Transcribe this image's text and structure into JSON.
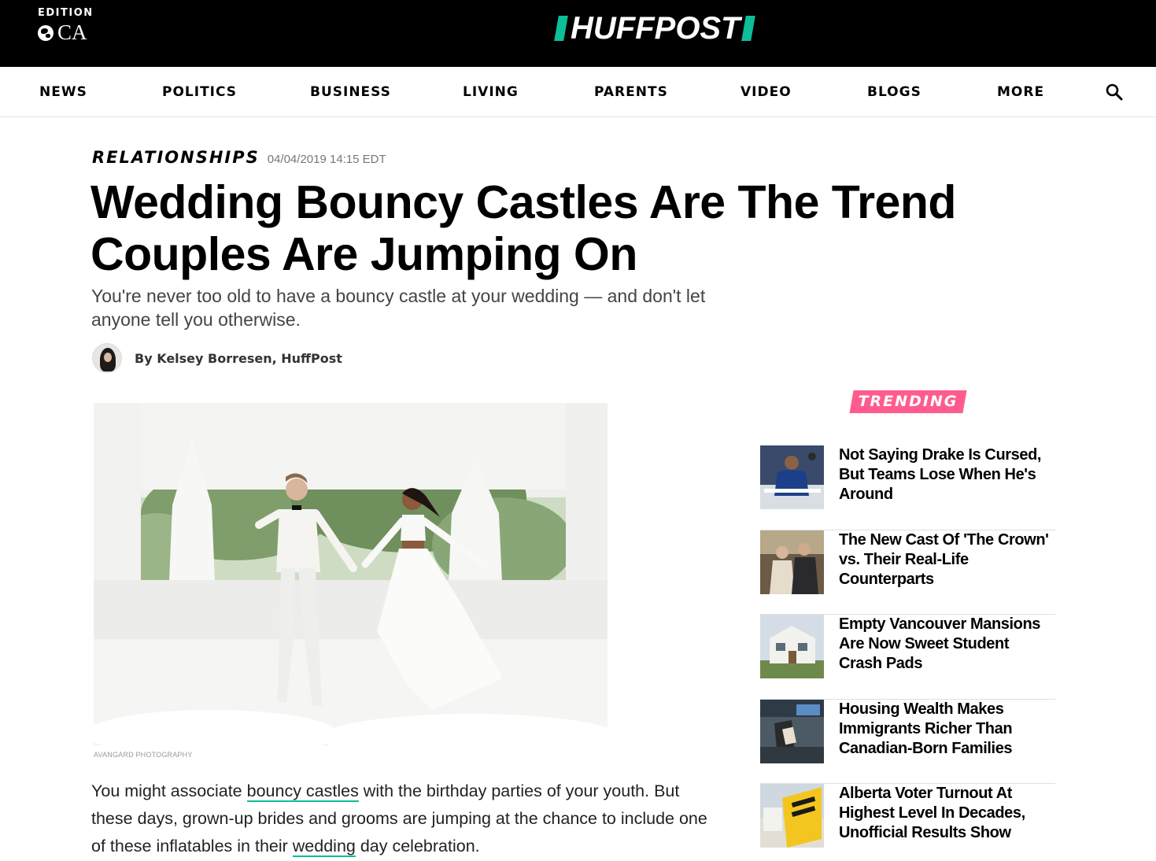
{
  "header": {
    "edition_label": "EDITION",
    "edition_code": "CA",
    "logo_text": "HUFFPOST"
  },
  "nav": {
    "items": [
      "NEWS",
      "POLITICS",
      "BUSINESS",
      "LIVING",
      "PARENTS",
      "VIDEO",
      "BLOGS",
      "MORE"
    ],
    "search_icon": "search-icon"
  },
  "article": {
    "section": "RELATIONSHIPS",
    "timestamp": "04/04/2019 14:15 EDT",
    "headline": "Wedding Bouncy Castles Are The Trend Couples Are Jumping On",
    "dek": "You're never too old to have a bouncy castle at your wedding — and don't let anyone tell you otherwise.",
    "byline": "By Kelsey Borresen, HuffPost",
    "image_credit": "AVANGARD PHOTOGRAPHY",
    "body": {
      "p1_a": "You might associate ",
      "p1_link1": "bouncy castles",
      "p1_b": " with the birthday parties of your youth. But these days, grown-up brides and grooms are jumping at the chance to include one of these inflatables in their ",
      "p1_link2": "wedding",
      "p1_c": " day celebration."
    }
  },
  "trending": {
    "label": "TRENDING",
    "items": [
      {
        "title": "Not Saying Drake Is Cursed, But Teams Lose When He's Around"
      },
      {
        "title": "The New Cast Of 'The Crown' vs. Their Real-Life Counterparts"
      },
      {
        "title": "Empty Vancouver Mansions Are Now Sweet Student Crash Pads"
      },
      {
        "title": "Housing Wealth Makes Immigrants Richer Than Canadian-Born Families"
      },
      {
        "title": "Alberta Voter Turnout At Highest Level In Decades, Unofficial Results Show"
      }
    ]
  },
  "colors": {
    "brand_green": "#0dbe98",
    "trending_pink": "#ff5c8d"
  }
}
